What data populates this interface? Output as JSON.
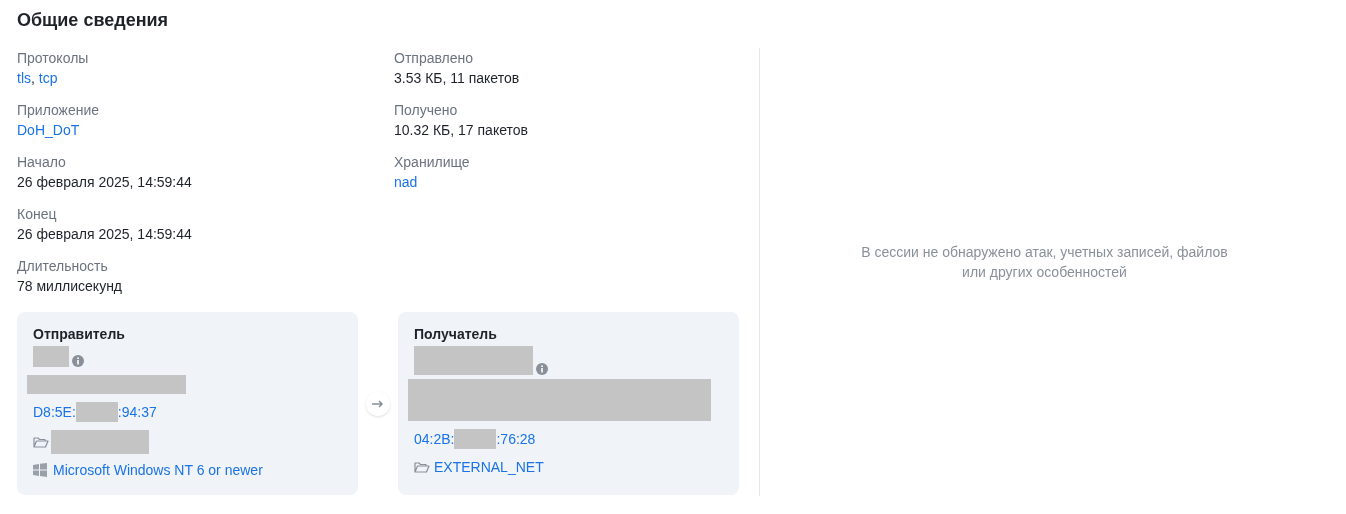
{
  "title": "Общие сведения",
  "columns": [
    [
      {
        "label": "Протоколы",
        "value": [
          {
            "kind": "link",
            "text": "tls"
          },
          {
            "kind": "text",
            "text": ", "
          },
          {
            "kind": "link",
            "text": "tcp"
          }
        ]
      },
      {
        "label": "Приложение",
        "value": [
          {
            "kind": "link",
            "text": "DoH_DoT"
          }
        ]
      },
      {
        "label": "Начало",
        "value": [
          {
            "kind": "text",
            "text": "26 февраля 2025, 14:59:44"
          }
        ]
      },
      {
        "label": "Конец",
        "value": [
          {
            "kind": "text",
            "text": "26 февраля 2025, 14:59:44"
          }
        ]
      },
      {
        "label": "Длительность",
        "value": [
          {
            "kind": "text",
            "text": "78 миллисекунд"
          }
        ]
      }
    ],
    [
      {
        "label": "Отправлено",
        "value": [
          {
            "kind": "text",
            "text": "3.53 КБ, 11 пакетов"
          }
        ]
      },
      {
        "label": "Получено",
        "value": [
          {
            "kind": "text",
            "text": "10.32 КБ, 17 пакетов"
          }
        ]
      },
      {
        "label": "Хранилище",
        "value": [
          {
            "kind": "link",
            "text": "nad"
          }
        ]
      }
    ]
  ],
  "sender": {
    "title": "Отправитель",
    "mac_prefix": "D8:5E:",
    "mac_suffix": ":94:37",
    "os": "Microsoft Windows NT 6 or newer"
  },
  "receiver": {
    "title": "Получатель",
    "mac_prefix": "04:2B:",
    "mac_suffix": ":76:28",
    "group": "EXTERNAL_NET"
  },
  "empty_message": "В сессии не обнаружено атак, учетных записей, файлов или других особенностей"
}
